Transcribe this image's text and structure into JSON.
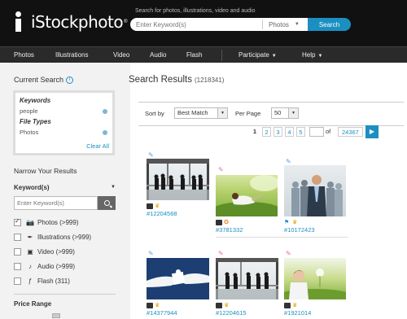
{
  "header": {
    "logo_text": "iStockphoto",
    "logo_reg": "®",
    "search_caption": "Search for photos, illustrations, video and audio",
    "search_placeholder": "Enter Keyword(s)",
    "search_type": "Photos",
    "search_button": "Search"
  },
  "nav": {
    "items": [
      "Photos",
      "Illustrations",
      "Video",
      "Audio",
      "Flash",
      "Participate",
      "Help"
    ]
  },
  "sidebar": {
    "current_search_title": "Current Search",
    "info_symbol": "i",
    "keywords_label": "Keywords",
    "keywords_value": "people",
    "file_types_label": "File Types",
    "file_types_value": "Photos",
    "clear_all": "Clear All",
    "narrow_title": "Narrow Your Results",
    "kw_title": "Keyword(s)",
    "kw_placeholder": "Enter Keyword(s)",
    "types": [
      {
        "label": "Photos",
        "count": "(>999)",
        "checked": true,
        "icon": "camera-icon",
        "glyph": "📷"
      },
      {
        "label": "Illustrations",
        "count": "(>999)",
        "checked": false,
        "icon": "pen-icon",
        "glyph": "✒"
      },
      {
        "label": "Video",
        "count": "(>999)",
        "checked": false,
        "icon": "film-icon",
        "glyph": "▣"
      },
      {
        "label": "Audio",
        "count": "(>999)",
        "checked": false,
        "icon": "music-note-icon",
        "glyph": "♪"
      },
      {
        "label": "Flash",
        "count": "(311)",
        "checked": false,
        "icon": "flash-icon",
        "glyph": "ƒ"
      }
    ],
    "price_title": "Price Range"
  },
  "main": {
    "title": "Search Results",
    "count": "(1218341)",
    "sort_label": "Sort by",
    "sort_value": "Best Match",
    "per_page_label": "Per Page",
    "per_page_value": "50",
    "pager": {
      "current": "1",
      "pages": [
        "2",
        "3",
        "4",
        "5"
      ],
      "of_label": "of",
      "total": "24367",
      "next": "▶"
    },
    "thumbs": [
      {
        "id": "#12204568",
        "lightbox": "blue",
        "icons": [
          "camera",
          "crown"
        ]
      },
      {
        "id": "#3781332",
        "lightbox": "pink",
        "icons": [
          "camera",
          "ribbon"
        ]
      },
      {
        "id": "#10172423",
        "lightbox": "blue",
        "icons": [
          "flag",
          "crown"
        ]
      },
      {
        "id": "#14377944",
        "lightbox": "blue",
        "icons": [
          "camera",
          "crown"
        ]
      },
      {
        "id": "#12204615",
        "lightbox": "pink",
        "icons": [
          "camera",
          "crown"
        ]
      },
      {
        "id": "#1921014",
        "lightbox": "pink",
        "icons": [
          "camera",
          "crown"
        ]
      }
    ]
  },
  "colors": {
    "accent": "#1c8fc1",
    "header_bg": "#111111",
    "nav_bg": "#2a2a2a",
    "sidebar_bg": "#f2f2f2"
  }
}
